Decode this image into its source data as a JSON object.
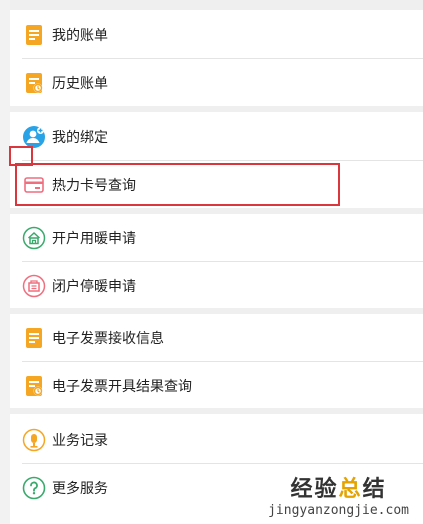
{
  "groups": [
    {
      "items": [
        {
          "label": "我的账单",
          "icon": "bill-icon"
        },
        {
          "label": "历史账单",
          "icon": "history-bill-icon"
        }
      ]
    },
    {
      "items": [
        {
          "label": "我的绑定",
          "icon": "user-bind-icon"
        },
        {
          "label": "热力卡号查询",
          "icon": "card-icon"
        }
      ]
    },
    {
      "items": [
        {
          "label": "开户用暖申请",
          "icon": "open-heating-icon"
        },
        {
          "label": "闭户停暖申请",
          "icon": "close-heating-icon"
        }
      ]
    },
    {
      "items": [
        {
          "label": "电子发票接收信息",
          "icon": "invoice-receive-icon"
        },
        {
          "label": "电子发票开具结果查询",
          "icon": "invoice-result-icon"
        }
      ]
    },
    {
      "items": [
        {
          "label": "业务记录",
          "icon": "record-icon"
        },
        {
          "label": "更多服务",
          "icon": "help-icon"
        }
      ]
    }
  ],
  "watermark": {
    "title_main": "经验",
    "title_accent": "总",
    "title_end": "结",
    "url": "jingyanzongjie.com"
  },
  "colors": {
    "orange": "#f5a623",
    "blue": "#29a3e6",
    "pink": "#ef6f7e",
    "green": "#3aa96c",
    "highlight": "#d9363e"
  }
}
